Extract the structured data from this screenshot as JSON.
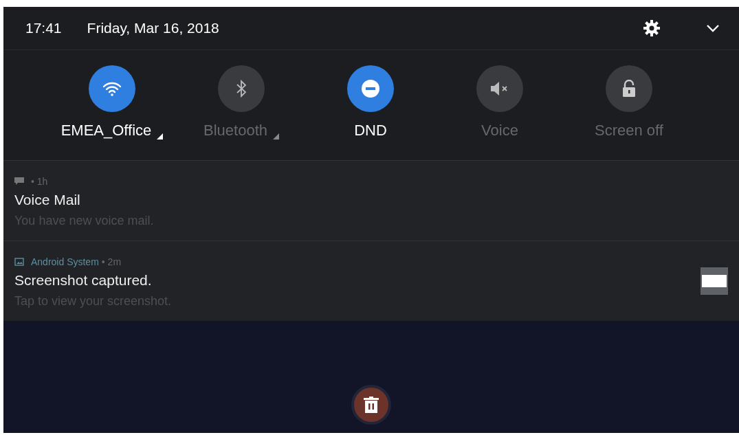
{
  "status_bar": {
    "time": "17:41",
    "date": "Friday, Mar 16, 2018"
  },
  "tiles": [
    {
      "kind": "wifi",
      "label": "EMEA_Office",
      "on": true,
      "has_menu": true
    },
    {
      "kind": "bluetooth",
      "label": "Bluetooth",
      "on": false,
      "has_menu": true
    },
    {
      "kind": "dnd",
      "label": "DND",
      "on": true,
      "has_menu": false
    },
    {
      "kind": "voice",
      "label": "Voice",
      "on": false,
      "has_menu": false
    },
    {
      "kind": "lock",
      "label": "Screen off",
      "on": false,
      "has_menu": false
    }
  ],
  "notifications": [
    {
      "kind": "message",
      "time": "• 1h",
      "title": "Voice Mail",
      "body": "You have new voice mail.",
      "thumbnail": false
    },
    {
      "kind": "image",
      "app": "Android System",
      "time": "• 2m",
      "title": "Screenshot captured.",
      "body": "Tap to view your screenshot.",
      "thumbnail": true
    }
  ]
}
